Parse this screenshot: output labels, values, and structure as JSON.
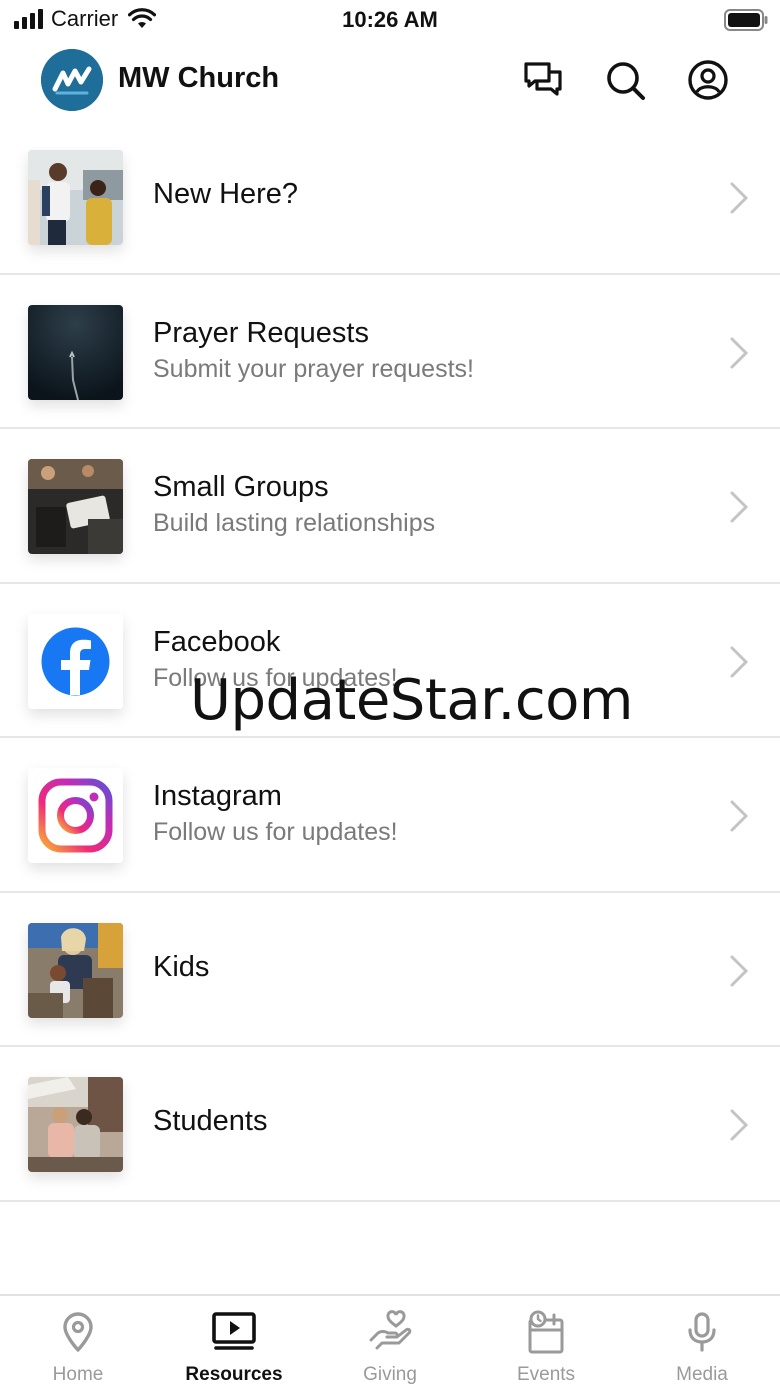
{
  "status_bar": {
    "carrier": "Carrier",
    "time": "10:26 AM"
  },
  "header": {
    "title": "MW Church",
    "icons": [
      "chat-icon",
      "search-icon",
      "profile-icon"
    ]
  },
  "resources": [
    {
      "title": "New Here?",
      "subtitle": "",
      "thumb": "new-here-thumbnail"
    },
    {
      "title": "Prayer Requests",
      "subtitle": "Submit your prayer requests!",
      "thumb": "prayer-thumbnail"
    },
    {
      "title": "Small Groups",
      "subtitle": "Build lasting relationships",
      "thumb": "small-groups-thumbnail"
    },
    {
      "title": "Facebook",
      "subtitle": "Follow us for updates!",
      "thumb": "facebook-icon"
    },
    {
      "title": "Instagram",
      "subtitle": "Follow us for updates!",
      "thumb": "instagram-icon"
    },
    {
      "title": "Kids",
      "subtitle": "",
      "thumb": "kids-thumbnail"
    },
    {
      "title": "Students",
      "subtitle": "",
      "thumb": "students-thumbnail"
    }
  ],
  "watermark": "UpdateStar.com",
  "tabs": [
    {
      "label": "Home",
      "icon": "location-pin-icon",
      "active": false
    },
    {
      "label": "Resources",
      "icon": "tv-play-icon",
      "active": true
    },
    {
      "label": "Giving",
      "icon": "hand-heart-icon",
      "active": false
    },
    {
      "label": "Events",
      "icon": "calendar-clock-icon",
      "active": false
    },
    {
      "label": "Media",
      "icon": "microphone-icon",
      "active": false
    }
  ],
  "colors": {
    "brand": "#1f6e9a",
    "facebook": "#1877f2",
    "inactive_tab": "#9a9a9a",
    "subtitle": "#7a7a7a"
  }
}
